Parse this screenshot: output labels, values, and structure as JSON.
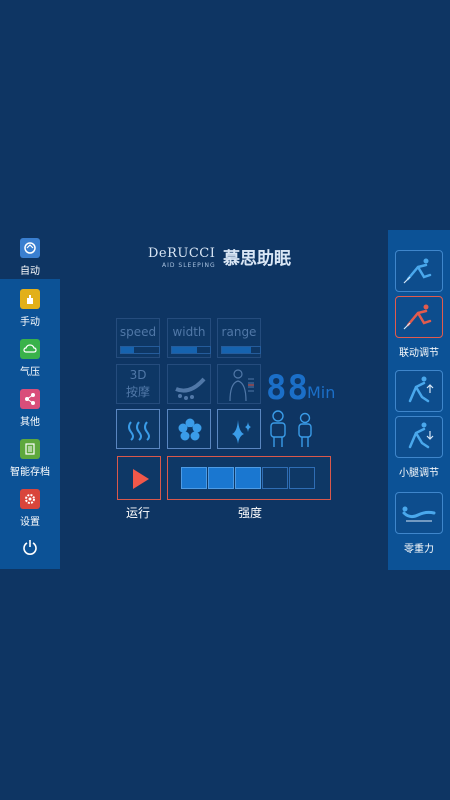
{
  "logo": {
    "brand": "DeRUCCI",
    "sub": "AID SLEEPING",
    "cn": "慕思助眠"
  },
  "left_nav": [
    {
      "label": "自动",
      "icon": "auto-icon",
      "color": "#3a7fd0"
    },
    {
      "label": "手动",
      "icon": "hand-icon",
      "color": "#e2b019"
    },
    {
      "label": "气压",
      "icon": "cloud-icon",
      "color": "#39b24a"
    },
    {
      "label": "其他",
      "icon": "share-icon",
      "color": "#d94e7a"
    },
    {
      "label": "智能存档",
      "icon": "document-icon",
      "color": "#5ea83d"
    },
    {
      "label": "设置",
      "icon": "gear-icon",
      "color": "#d9453b"
    }
  ],
  "power": {
    "icon": "power-icon"
  },
  "right_nav": [
    {
      "label": "联动调节",
      "icon": "recline-icon"
    },
    {
      "label": "小腿调节",
      "icon": "calf-icon"
    },
    {
      "label": "零重力",
      "icon": "zero-gravity-icon"
    }
  ],
  "controls": {
    "speed": {
      "label": "speed",
      "level": 0.33
    },
    "width": {
      "label": "width",
      "level": 0.66
    },
    "range": {
      "label": "range",
      "level": 0.75
    },
    "mode3d": {
      "line1": "3D",
      "line2": "按摩"
    },
    "timer": {
      "value": "88",
      "unit": "Min"
    }
  },
  "run": {
    "label": "运行"
  },
  "intensity": {
    "label": "强度",
    "segments": 5,
    "active": 3
  },
  "colors": {
    "background": "#0e3563",
    "panel": "#0c5296",
    "accent": "#1a77d0",
    "alert": "#e25b4d"
  }
}
